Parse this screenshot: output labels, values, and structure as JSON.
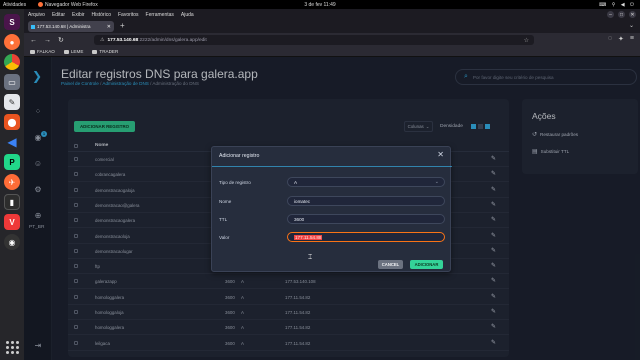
{
  "topbar": {
    "activities": "Atividades",
    "app": "Navegador Web Firefox",
    "clock": "3 de fev  11:49"
  },
  "firefox": {
    "menu": [
      "Arquivo",
      "Editar",
      "Exibir",
      "Histórico",
      "Favoritos",
      "Ferramentas",
      "Ajuda"
    ],
    "tab_title": "177.53.140.68 | Administra",
    "url_host": "177.53.140.68",
    "url_path": ":2222/admin/dns/galera.app/edit",
    "bookmarks": [
      "FALKAO",
      "LEME",
      "TRADER"
    ]
  },
  "app": {
    "title": "Editar registros DNS para galera.app",
    "crumb_link1": "Painel de Controle",
    "crumb_link2": "Administração de DNS",
    "crumb_current": "Administração do DNS",
    "search_placeholder": "Por favor digite seu critério de pesquisa",
    "lang": "PT_BR"
  },
  "table": {
    "add_label": "ADICIONAR REGISTRO",
    "columns_label": "Colunas",
    "density_label": "Densidade",
    "col_name": "Nome",
    "rows": [
      {
        "name": "comercial",
        "ttl": "",
        "type": "",
        "value": ""
      },
      {
        "name": "cobrancagalera",
        "ttl": "",
        "type": "",
        "value": ""
      },
      {
        "name": "demonstracaogaloja",
        "ttl": "",
        "type": "",
        "value": ""
      },
      {
        "name": "demonstracao@galera",
        "ttl": "",
        "type": "",
        "value": ""
      },
      {
        "name": "demonstracaogalera",
        "ttl": "",
        "type": "",
        "value": ""
      },
      {
        "name": "demonstracaoloja",
        "ttl": "",
        "type": "",
        "value": ""
      },
      {
        "name": "demonstracaolugar",
        "ttl": "",
        "type": "",
        "value": ""
      },
      {
        "name": "ftp",
        "ttl": "",
        "type": "",
        "value": ""
      },
      {
        "name": "galerazapp",
        "ttl": "3600",
        "type": "A",
        "value": "177.53.140.108"
      },
      {
        "name": "homologgalera",
        "ttl": "3600",
        "type": "A",
        "value": "177.11.54.82"
      },
      {
        "name": "homologgaloja",
        "ttl": "3600",
        "type": "A",
        "value": "177.11.54.82"
      },
      {
        "name": "homologgalera",
        "ttl": "3600",
        "type": "A",
        "value": "177.11.54.82"
      },
      {
        "name": "leilgaca",
        "ttl": "3600",
        "type": "A",
        "value": "177.11.54.82"
      }
    ]
  },
  "actions": {
    "title": "Ações",
    "restore": "Restaurar padrões",
    "ttl": "Substituir TTL"
  },
  "modal": {
    "title": "Adicionar registro",
    "type_label": "Tipo de registro",
    "type_value": "A",
    "name_label": "Nome",
    "name_value": "iomatec",
    "ttl_label": "TTL",
    "ttl_value": "3600",
    "value_label": "Valor",
    "value_value": "177.11.54.88",
    "cancel": "CANCEL",
    "ok": "ADICIONAR"
  },
  "colors": {
    "accent": "#38bdf8",
    "success": "#34d399",
    "panel": "#262d3d",
    "background": "#1f2534"
  }
}
